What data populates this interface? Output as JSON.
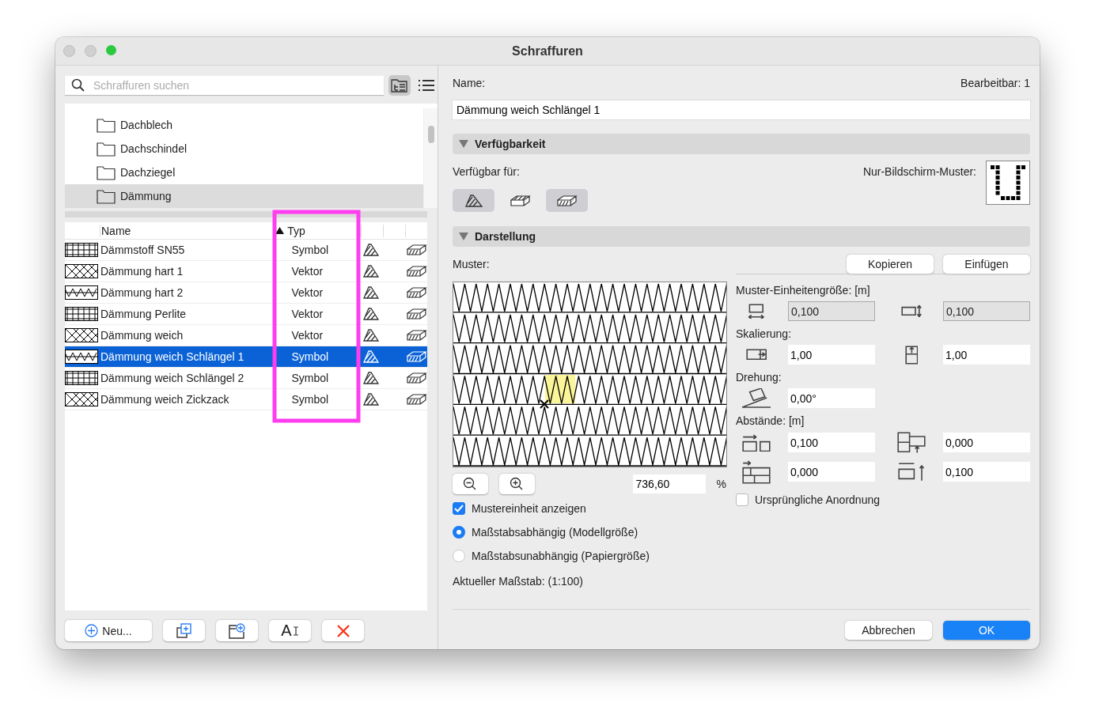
{
  "window": {
    "title": "Schraffuren"
  },
  "search": {
    "placeholder": "Schraffuren suchen"
  },
  "view_buttons": [
    {
      "kind": "tree",
      "selected": true
    },
    {
      "kind": "list",
      "selected": false
    }
  ],
  "folders": [
    {
      "name": "Dachblech",
      "selected": false
    },
    {
      "name": "Dachschindel",
      "selected": false
    },
    {
      "name": "Dachziegel",
      "selected": false
    },
    {
      "name": "Dämmung",
      "selected": true
    }
  ],
  "table": {
    "columns": [
      {
        "label": "Name",
        "sorted": false
      },
      {
        "label": "Typ",
        "sorted": true
      }
    ],
    "rows": [
      {
        "name": "Dämmstoff SN55",
        "type": "Symbol",
        "selected": false
      },
      {
        "name": "Dämmung hart 1",
        "type": "Vektor",
        "selected": false
      },
      {
        "name": "Dämmung hart 2",
        "type": "Vektor",
        "selected": false
      },
      {
        "name": "Dämmung Perlite",
        "type": "Vektor",
        "selected": false
      },
      {
        "name": "Dämmung weich",
        "type": "Vektor",
        "selected": false
      },
      {
        "name": "Dämmung weich Schlängel 1",
        "type": "Symbol",
        "selected": true
      },
      {
        "name": "Dämmung weich Schlängel 2",
        "type": "Symbol",
        "selected": false
      },
      {
        "name": "Dämmung weich Zickzack",
        "type": "Symbol",
        "selected": false
      }
    ]
  },
  "highlight": {
    "kind": "rectangle"
  },
  "bottom_buttons": [
    {
      "kind": "new",
      "label": "Neu..."
    },
    {
      "kind": "duplicate"
    },
    {
      "kind": "new-folder"
    },
    {
      "kind": "rename",
      "label": "A"
    },
    {
      "kind": "delete"
    }
  ],
  "name_label": "Name:",
  "editable": "Bearbeitbar: 1",
  "name_value": "Dämmung weich Schlängel 1",
  "availability": {
    "title": "Verfügbarkeit",
    "expanded": true,
    "label": "Verfügbar für:",
    "screen_label": "Nur-Bildschirm-Muster:",
    "toggles": [
      {
        "kind": "fill",
        "on": true
      },
      {
        "kind": "cut",
        "on": false
      },
      {
        "kind": "cover",
        "on": true
      }
    ]
  },
  "display": {
    "title": "Darstellung",
    "expanded": true,
    "pattern_label": "Muster:",
    "copy": "Kopieren",
    "paste": "Einfügen",
    "zoom": "736,60",
    "percent": "%",
    "show_unit": {
      "label": "Mustereinheit anzeigen",
      "checked": true
    },
    "scale_modes": [
      {
        "label": "Maßstabsabhängig (Modellgröße)",
        "selected": true
      },
      {
        "label": "Maßstabsunabhängig (Papiergröße)",
        "selected": false
      }
    ],
    "current_scale": "Aktueller Maßstab: (1:100)",
    "groups": [
      {
        "title": "Muster-Einheitengröße: [m]",
        "fields": [
          {
            "kind": "width",
            "value": "0,100",
            "disabled": true
          },
          {
            "kind": "height",
            "value": "0,100",
            "disabled": true
          }
        ]
      },
      {
        "title": "Skalierung:",
        "fields": [
          {
            "kind": "scale-x",
            "value": "1,00",
            "disabled": false
          },
          {
            "kind": "scale-y",
            "value": "1,00",
            "disabled": false
          }
        ]
      },
      {
        "title": "Drehung:",
        "fields": [
          {
            "kind": "angle",
            "value": "0,00°",
            "disabled": false
          }
        ]
      },
      {
        "title": "Abstände: [m]",
        "fields": [
          {
            "kind": "gap-x",
            "value": "0,100",
            "disabled": false
          },
          {
            "kind": "shift-y",
            "value": "0,000",
            "disabled": false
          },
          {
            "kind": "shift-x",
            "value": "0,000",
            "disabled": false
          },
          {
            "kind": "gap-y",
            "value": "0,100",
            "disabled": false
          }
        ]
      }
    ],
    "original_layout": {
      "label": "Ursprüngliche Anordnung",
      "checked": false
    }
  },
  "buttons": [
    {
      "label": "Abbrechen",
      "primary": false
    },
    {
      "label": "OK",
      "primary": true
    }
  ]
}
